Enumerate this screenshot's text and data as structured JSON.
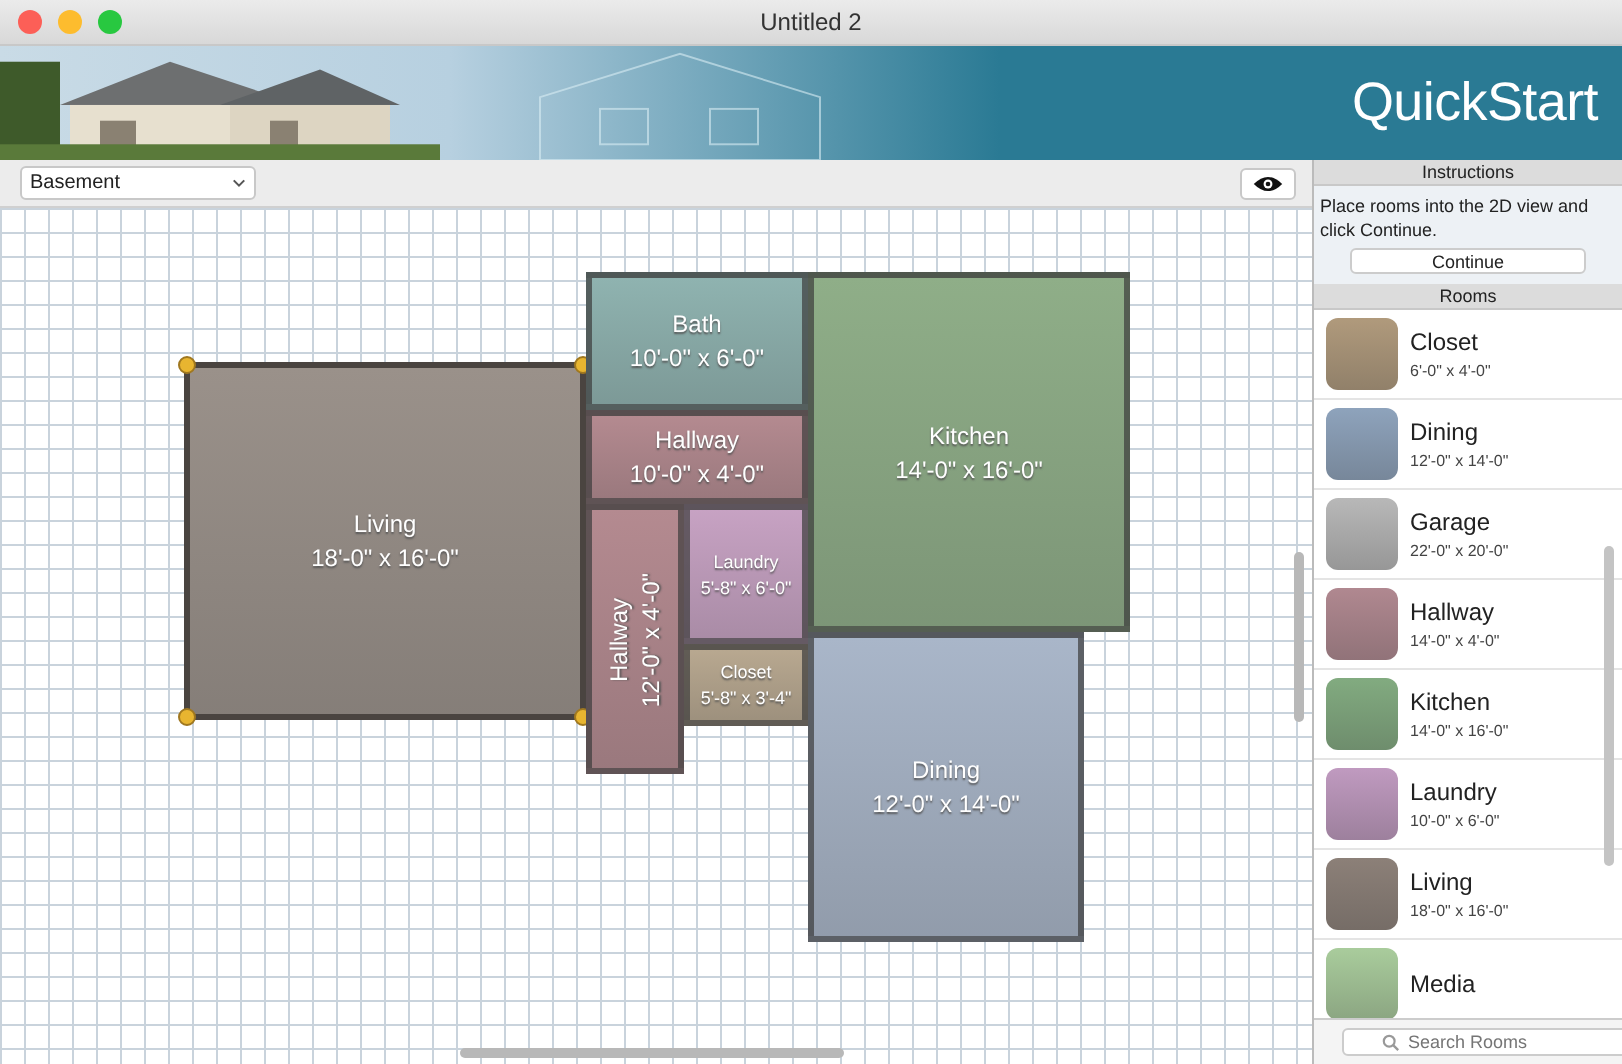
{
  "window": {
    "title": "Untitled 2"
  },
  "banner": {
    "title": "QuickStart"
  },
  "toolbar": {
    "level_select": "Basement"
  },
  "plan": {
    "rooms": [
      {
        "name": "Living",
        "size": "18'-0\" x 16'-0\"",
        "kind": "horizontal",
        "color": "#9a918a",
        "selected": true
      },
      {
        "name": "Bath",
        "size": "10'-0\" x 6'-0\"",
        "kind": "horizontal",
        "color": "#8fb3b0",
        "selected": false
      },
      {
        "name": "Hallway",
        "size": "10'-0\" x 4'-0\"",
        "kind": "horizontal",
        "color": "#b48a90",
        "selected": false
      },
      {
        "name": "Hallway",
        "size": "12'-0\" x 4'-0\"",
        "kind": "vertical",
        "color": "#b48a90",
        "selected": false
      },
      {
        "name": "Laundry",
        "size": "5'-8\" x 6'-0\"",
        "kind": "horizontal",
        "color": "#c7a2c3",
        "selected": false
      },
      {
        "name": "Closet",
        "size": "5'-8\" x 3'-4\"",
        "kind": "horizontal",
        "color": "#b8a890",
        "selected": false
      },
      {
        "name": "Kitchen",
        "size": "14'-0\" x 16'-0\"",
        "kind": "horizontal",
        "color": "#8fae88",
        "selected": false
      },
      {
        "name": "Dining",
        "size": "12'-0\" x 14'-0\"",
        "kind": "horizontal",
        "color": "#a9b6c9",
        "selected": false
      }
    ]
  },
  "instructions": {
    "header": "Instructions",
    "text": "Place rooms into the 2D view and click Continue.",
    "button": "Continue"
  },
  "rooms_panel": {
    "header": "Rooms",
    "search": {
      "placeholder": "Search Rooms"
    },
    "items": [
      {
        "name": "Closet",
        "size": "6'-0\" x 4'-0\"",
        "color": "#b09a7c"
      },
      {
        "name": "Dining",
        "size": "12'-0\" x 14'-0\"",
        "color": "#8ea3bc"
      },
      {
        "name": "Garage",
        "size": "22'-0\" x 20'-0\"",
        "color": "#b8b8b8"
      },
      {
        "name": "Hallway",
        "size": "14'-0\" x 4'-0\"",
        "color": "#b08890"
      },
      {
        "name": "Kitchen",
        "size": "14'-0\" x 16'-0\"",
        "color": "#82ab80"
      },
      {
        "name": "Laundry",
        "size": "10'-0\" x 6'-0\"",
        "color": "#c09ac0"
      },
      {
        "name": "Living",
        "size": "18'-0\" x 16'-0\"",
        "color": "#8c8078"
      },
      {
        "name": "Media",
        "color": "#a9cc9c"
      }
    ]
  }
}
